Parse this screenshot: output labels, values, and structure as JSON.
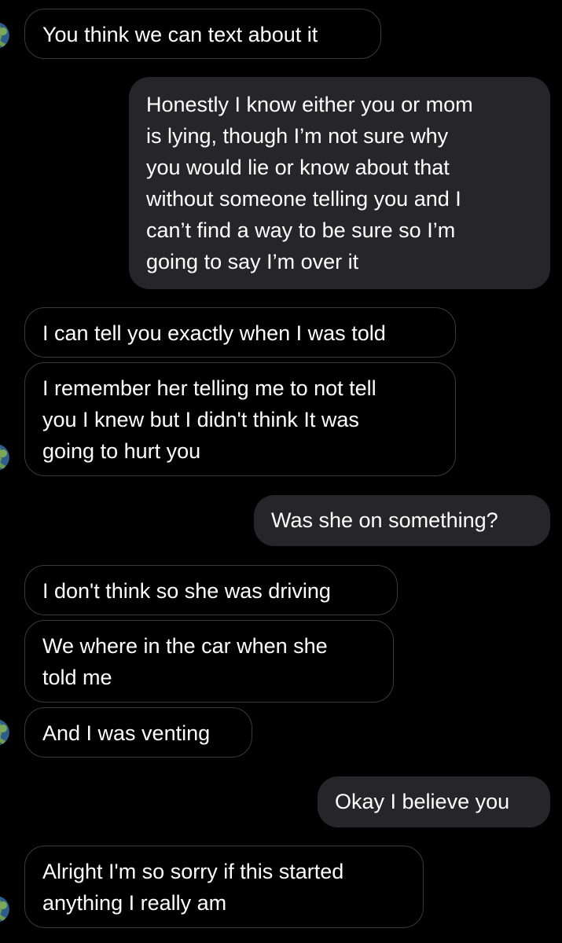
{
  "conversation": {
    "messages": [
      {
        "side": "received",
        "text": "You think we can text about it"
      },
      {
        "side": "sent",
        "text": "Honestly I know either you or mom\nis lying, though I’m not sure why\nyou would lie or know about that\nwithout someone telling you and I\ncan’t find a way to be sure so I’m\ngoing to say I’m over it"
      },
      {
        "side": "received",
        "text": "I can tell you exactly when I was told"
      },
      {
        "side": "received",
        "text": "I remember her telling me to not tell\nyou I knew but I didn't think It was\ngoing to hurt you"
      },
      {
        "side": "sent",
        "text": "Was she on something?"
      },
      {
        "side": "received",
        "text": "I don't think so she was driving"
      },
      {
        "side": "received",
        "text": "We where in the car when she\ntold me"
      },
      {
        "side": "received",
        "text": "And I was venting"
      },
      {
        "side": "sent",
        "text": "Okay I believe you"
      },
      {
        "side": "received",
        "text": "Alright I'm so sorry if this started\nanything I really am"
      }
    ],
    "avatar_icon": "globe-avatar-icon"
  },
  "colors": {
    "background": "#000000",
    "sent_bubble": "#262628",
    "received_border": "#3a3a3c",
    "text": "#ffffff"
  }
}
